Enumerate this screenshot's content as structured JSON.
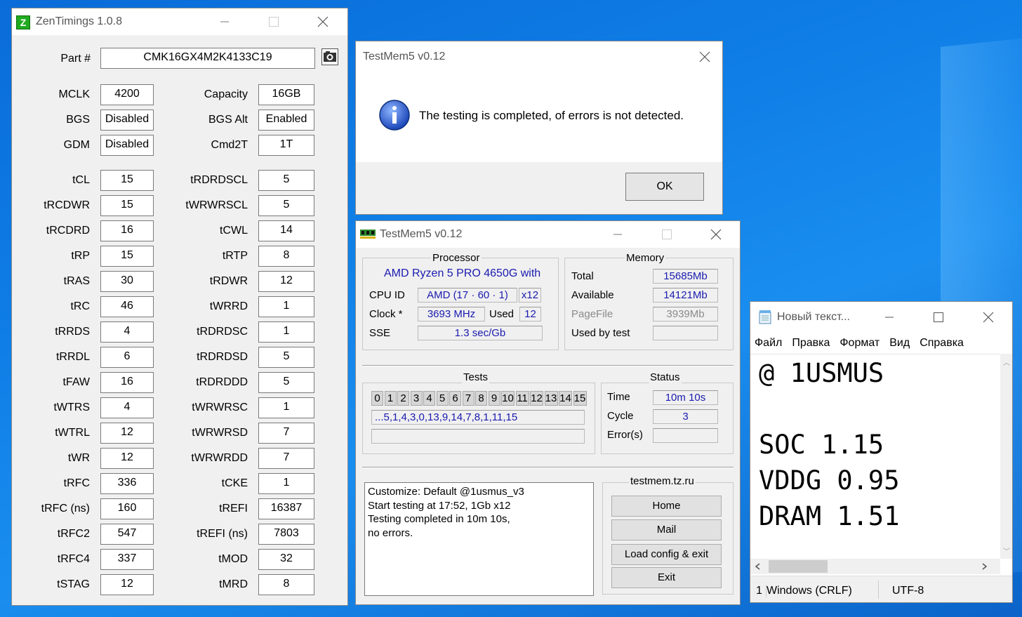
{
  "zen": {
    "title": "ZenTimings 1.0.8",
    "logo": "Z",
    "part_label": "Part #",
    "part_value": "CMK16GX4M2K4133C19",
    "left": [
      {
        "label": "MCLK",
        "value": "4200"
      },
      {
        "label": "BGS",
        "value": "Disabled"
      },
      {
        "label": "GDM",
        "value": "Disabled"
      },
      {
        "label": "tCL",
        "value": "15"
      },
      {
        "label": "tRCDWR",
        "value": "15"
      },
      {
        "label": "tRCDRD",
        "value": "16"
      },
      {
        "label": "tRP",
        "value": "15"
      },
      {
        "label": "tRAS",
        "value": "30"
      },
      {
        "label": "tRC",
        "value": "46"
      },
      {
        "label": "tRRDS",
        "value": "4"
      },
      {
        "label": "tRRDL",
        "value": "6"
      },
      {
        "label": "tFAW",
        "value": "16"
      },
      {
        "label": "tWTRS",
        "value": "4"
      },
      {
        "label": "tWTRL",
        "value": "12"
      },
      {
        "label": "tWR",
        "value": "12"
      },
      {
        "label": "tRFC",
        "value": "336"
      },
      {
        "label": "tRFC (ns)",
        "value": "160"
      },
      {
        "label": "tRFC2",
        "value": "547"
      },
      {
        "label": "tRFC4",
        "value": "337"
      },
      {
        "label": "tSTAG",
        "value": "12"
      }
    ],
    "right": [
      {
        "label": "Capacity",
        "value": "16GB"
      },
      {
        "label": "BGS Alt",
        "value": "Enabled"
      },
      {
        "label": "Cmd2T",
        "value": "1T"
      },
      {
        "label": "tRDRDSCL",
        "value": "5"
      },
      {
        "label": "tWRWRSCL",
        "value": "5"
      },
      {
        "label": "tCWL",
        "value": "14"
      },
      {
        "label": "tRTP",
        "value": "8"
      },
      {
        "label": "tRDWR",
        "value": "12"
      },
      {
        "label": "tWRRD",
        "value": "1"
      },
      {
        "label": "tRDRDSC",
        "value": "1"
      },
      {
        "label": "tRDRDSD",
        "value": "5"
      },
      {
        "label": "tRDRDDD",
        "value": "5"
      },
      {
        "label": "tWRWRSC",
        "value": "1"
      },
      {
        "label": "tWRWRSD",
        "value": "7"
      },
      {
        "label": "tWRWRDD",
        "value": "7"
      },
      {
        "label": "tCKE",
        "value": "1"
      },
      {
        "label": "tREFI",
        "value": "16387"
      },
      {
        "label": "tREFI (ns)",
        "value": "7803"
      },
      {
        "label": "tMOD",
        "value": "32"
      },
      {
        "label": "tMRD",
        "value": "8"
      }
    ]
  },
  "dialog": {
    "title": "TestMem5 v0.12",
    "message": "The testing is completed, of errors is not detected.",
    "ok": "OK"
  },
  "tm5": {
    "title": "TestMem5 v0.12",
    "processor": {
      "group": "Processor",
      "name": "AMD Ryzen 5 PRO 4650G with",
      "cpuid_label": "CPU ID",
      "cpuid_value": "AMD  (17 · 60 · 1)",
      "threads": "x12",
      "clock_label": "Clock *",
      "clock_value": "3693 MHz",
      "used_label": "Used",
      "used_value": "12",
      "sse_label": "SSE",
      "sse_value": "1.3 sec/Gb"
    },
    "memory": {
      "group": "Memory",
      "total_label": "Total",
      "total_value": "15685Mb",
      "avail_label": "Available",
      "avail_value": "14121Mb",
      "page_label": "PageFile",
      "page_value": "3939Mb",
      "used_label": "Used by test",
      "used_value": ""
    },
    "tests": {
      "group": "Tests",
      "numbers": [
        "0",
        "1",
        "2",
        "3",
        "4",
        "5",
        "6",
        "7",
        "8",
        "9",
        "10",
        "11",
        "12",
        "13",
        "14",
        "15"
      ],
      "sequence": "...5,1,4,3,0,13,9,14,7,8,1,11,15",
      "extra": ""
    },
    "status": {
      "group": "Status",
      "time_label": "Time",
      "time_value": "10m 10s",
      "cycle_label": "Cycle",
      "cycle_value": "3",
      "errors_label": "Error(s)",
      "errors_value": ""
    },
    "log": "Customize: Default @1usmus_v3\nStart testing at 17:52, 1Gb x12\nTesting completed in 10m 10s,\nno errors.",
    "site": "testmem.tz.ru",
    "buttons": {
      "home": "Home",
      "mail": "Mail",
      "load": "Load config & exit",
      "exit": "Exit"
    }
  },
  "notepad": {
    "title": "Новый текст...",
    "menu": [
      "Файл",
      "Правка",
      "Формат",
      "Вид",
      "Справка"
    ],
    "lines": [
      "@ 1USMUS",
      "",
      "SOC 1.15",
      "VDDG 0.95",
      "DRAM 1.51"
    ],
    "status_line": "1",
    "status_eol": "Windows (CRLF)",
    "status_enc": "UTF-8"
  }
}
